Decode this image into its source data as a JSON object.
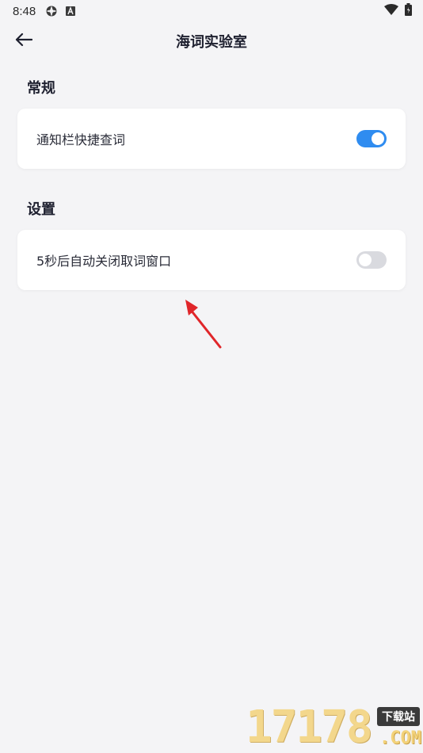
{
  "status_bar": {
    "time": "8:48",
    "icons": [
      "settings-icon",
      "app-a-icon"
    ],
    "right_icons": [
      "wifi-icon",
      "battery-icon"
    ]
  },
  "app_bar": {
    "title": "海词实验室",
    "back_icon": "back-arrow-icon"
  },
  "sections": [
    {
      "header": "常规",
      "items": [
        {
          "label": "通知栏快捷查词",
          "toggle": "on"
        }
      ]
    },
    {
      "header": "设置",
      "items": [
        {
          "label": "5秒后自动关闭取词窗口",
          "toggle": "off"
        }
      ]
    }
  ],
  "colors": {
    "accent": "#2f8cf0",
    "background": "#f4f4f6",
    "card": "#ffffff",
    "toggle_off": "#d9dadf",
    "annotation_arrow": "#e0262a"
  },
  "watermark": {
    "digits": "17178",
    "badge": "下载站",
    "suffix": ".COM"
  }
}
